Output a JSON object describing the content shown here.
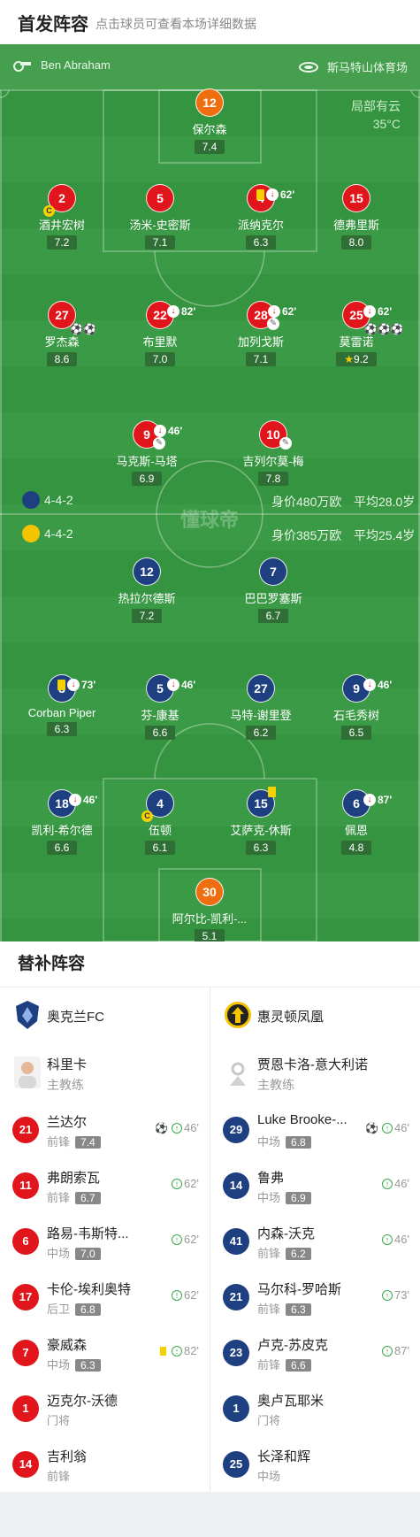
{
  "header": {
    "title": "首发阵容",
    "subtitle": "点击球员可查看本场详细数据"
  },
  "match": {
    "referee": "Ben Abraham",
    "venue": "斯马特山体育场",
    "weather": "局部有云",
    "temperature": "35°C",
    "watermark": "懂球帝"
  },
  "home": {
    "formation": "4-4-2",
    "value": "身价480万欧",
    "avg_age": "平均28.0岁",
    "players": [
      {
        "number": "12",
        "name": "保尔森",
        "rating": "7.4"
      },
      {
        "number": "2",
        "name": "酒井宏树",
        "rating": "7.2",
        "captain": "C"
      },
      {
        "number": "5",
        "name": "汤米-史密斯",
        "rating": "7.1"
      },
      {
        "number": "4",
        "name": "派纳克尔",
        "rating": "6.3",
        "sub_minute": "62'"
      },
      {
        "number": "15",
        "name": "德弗里斯",
        "rating": "8.0"
      },
      {
        "number": "27",
        "name": "罗杰森",
        "rating": "8.6",
        "goals": "⚽⚽"
      },
      {
        "number": "22",
        "name": "布里默",
        "rating": "7.0",
        "sub_minute": "82'"
      },
      {
        "number": "28",
        "name": "加列戈斯",
        "rating": "7.1",
        "sub_minute": "62'"
      },
      {
        "number": "25",
        "name": "莫雷诺",
        "rating": "9.2",
        "sub_minute": "62'",
        "goals": "⚽⚽⚽"
      },
      {
        "number": "9",
        "name": "马克斯-马塔",
        "rating": "6.9",
        "sub_minute": "46'"
      },
      {
        "number": "10",
        "name": "吉列尔莫-梅",
        "rating": "7.8"
      }
    ]
  },
  "away": {
    "formation": "4-4-2",
    "value": "身价385万欧",
    "avg_age": "平均25.4岁",
    "players": [
      {
        "number": "12",
        "name": "热拉尔德斯",
        "rating": "7.2"
      },
      {
        "number": "7",
        "name": "巴巴罗塞斯",
        "rating": "6.7"
      },
      {
        "number": "3",
        "name": "Corban Piper",
        "rating": "6.3",
        "sub_minute": "73'"
      },
      {
        "number": "5",
        "name": "芬-康基",
        "rating": "6.6",
        "sub_minute": "46'"
      },
      {
        "number": "27",
        "name": "马特-谢里登",
        "rating": "6.2"
      },
      {
        "number": "9",
        "name": "石毛秀树",
        "rating": "6.5",
        "sub_minute": "46'"
      },
      {
        "number": "18",
        "name": "凯利-希尔德",
        "rating": "6.6",
        "sub_minute": "46'"
      },
      {
        "number": "4",
        "name": "伍顿",
        "rating": "6.1",
        "captain": "C"
      },
      {
        "number": "15",
        "name": "艾萨克-休斯",
        "rating": "6.3"
      },
      {
        "number": "6",
        "name": "佩恩",
        "rating": "4.8",
        "sub_minute": "87'"
      },
      {
        "number": "30",
        "name": "阿尔比-凯利-...",
        "rating": "5.1"
      }
    ]
  },
  "subs": {
    "title": "替补阵容",
    "home": {
      "team": "奥克兰FC",
      "coach": "科里卡",
      "coach_role": "主教练",
      "players": [
        {
          "number": "21",
          "name": "兰达尔",
          "pos": "前锋",
          "rating": "7.4",
          "minute": "46'"
        },
        {
          "number": "11",
          "name": "弗朗索瓦",
          "pos": "前锋",
          "rating": "6.7",
          "minute": "62'"
        },
        {
          "number": "6",
          "name": "路易-韦斯特...",
          "pos": "中场",
          "rating": "7.0",
          "minute": "62'"
        },
        {
          "number": "17",
          "name": "卡伦-埃利奥特",
          "pos": "后卫",
          "rating": "6.8",
          "minute": "62'"
        },
        {
          "number": "7",
          "name": "豪威森",
          "pos": "中场",
          "rating": "6.3",
          "minute": "82'"
        },
        {
          "number": "1",
          "name": "迈克尔-沃德",
          "pos": "门将"
        },
        {
          "number": "14",
          "name": "吉利翁",
          "pos": "前锋"
        }
      ]
    },
    "away": {
      "team": "惠灵顿凤凰",
      "coach": "贾恩卡洛-意大利诺",
      "coach_role": "主教练",
      "players": [
        {
          "number": "29",
          "name": "Luke Brooke-...",
          "pos": "中场",
          "rating": "6.8",
          "minute": "46'"
        },
        {
          "number": "14",
          "name": "鲁弗",
          "pos": "中场",
          "rating": "6.9",
          "minute": "46'"
        },
        {
          "number": "41",
          "name": "内森-沃克",
          "pos": "前锋",
          "rating": "6.2",
          "minute": "46'"
        },
        {
          "number": "21",
          "name": "马尔科-罗哈斯",
          "pos": "前锋",
          "rating": "6.3",
          "minute": "73'"
        },
        {
          "number": "23",
          "name": "卢克-苏皮克",
          "pos": "前锋",
          "rating": "6.6",
          "minute": "87'"
        },
        {
          "number": "1",
          "name": "奥卢瓦耶米",
          "pos": "门将"
        },
        {
          "number": "25",
          "name": "长泽和辉",
          "pos": "中场"
        }
      ]
    }
  }
}
